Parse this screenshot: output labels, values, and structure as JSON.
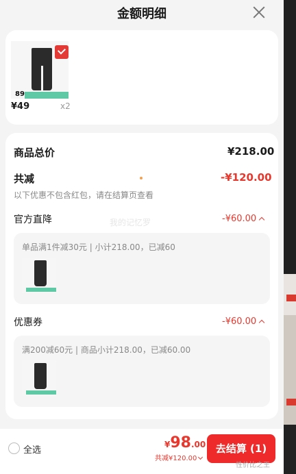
{
  "header": {
    "title": "金额明细"
  },
  "item": {
    "thumb_tag_price": "89",
    "price": "¥49",
    "qty": "x2"
  },
  "summary": {
    "total_label": "商品总价",
    "total_value": "¥218.00",
    "discount_label": "共减",
    "discount_value": "-¥120.00",
    "discount_note": "以下优惠不包含红包，请在结算页查看"
  },
  "watermark": "我的记忆罗",
  "sections": [
    {
      "title": "官方直降",
      "amount": "-¥60.00",
      "detail": "单品满1件减30元 | 小计218.00，已减60"
    },
    {
      "title": "优惠券",
      "amount": "-¥60.00",
      "detail": "满200减60元 | 商品小计218.00，已减60.00"
    }
  ],
  "bottom": {
    "select_all": "全选",
    "currency": "¥",
    "price_int": "98",
    "price_dec": ".00",
    "saved": "共减¥120.00",
    "checkout": "去结算 (1)",
    "corner_note": "性价比之王"
  },
  "colors": {
    "accent": "#ee2a2a",
    "discount_red": "#e8382e",
    "background": "#f4f4f4"
  }
}
